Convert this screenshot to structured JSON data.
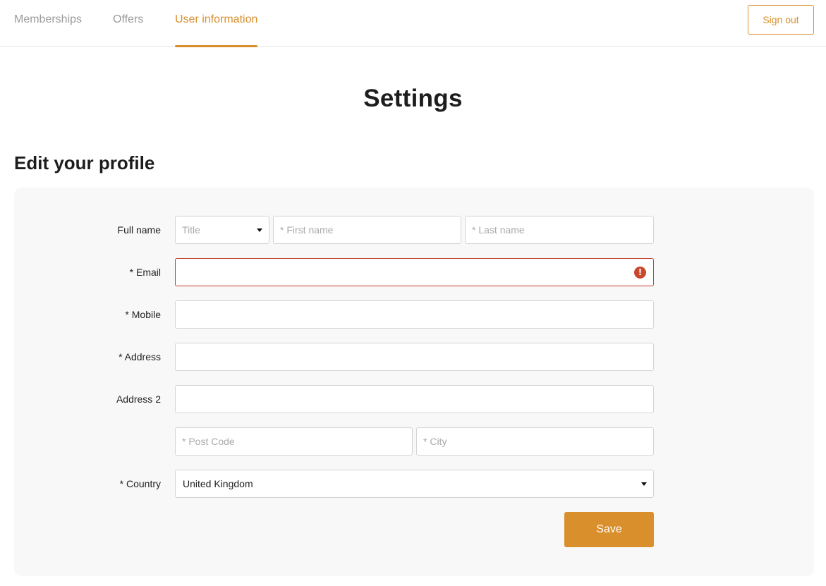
{
  "nav": {
    "tabs": [
      {
        "label": "Memberships"
      },
      {
        "label": "Offers"
      },
      {
        "label": "User information"
      }
    ],
    "sign_out": "Sign out"
  },
  "page_title": "Settings",
  "section_title": "Edit your profile",
  "form": {
    "full_name": {
      "label": "Full name",
      "title_placeholder": "Title",
      "first_name_placeholder": "* First name",
      "last_name_placeholder": "* Last name"
    },
    "email": {
      "label": "* Email",
      "value": "",
      "error_icon": "!"
    },
    "mobile": {
      "label": "* Mobile",
      "value": ""
    },
    "address": {
      "label": "* Address",
      "value": ""
    },
    "address2": {
      "label": "Address 2",
      "value": ""
    },
    "post_code_placeholder": "* Post Code",
    "city_placeholder": "* City",
    "country": {
      "label": "* Country",
      "value": "United Kingdom"
    },
    "save_label": "Save"
  },
  "colors": {
    "accent": "#d98f2b",
    "error": "#c8472d",
    "panel_bg": "#f8f8f8"
  },
  "icons": {
    "error": "exclamation-circle-icon",
    "dropdown": "caret-down-icon"
  }
}
